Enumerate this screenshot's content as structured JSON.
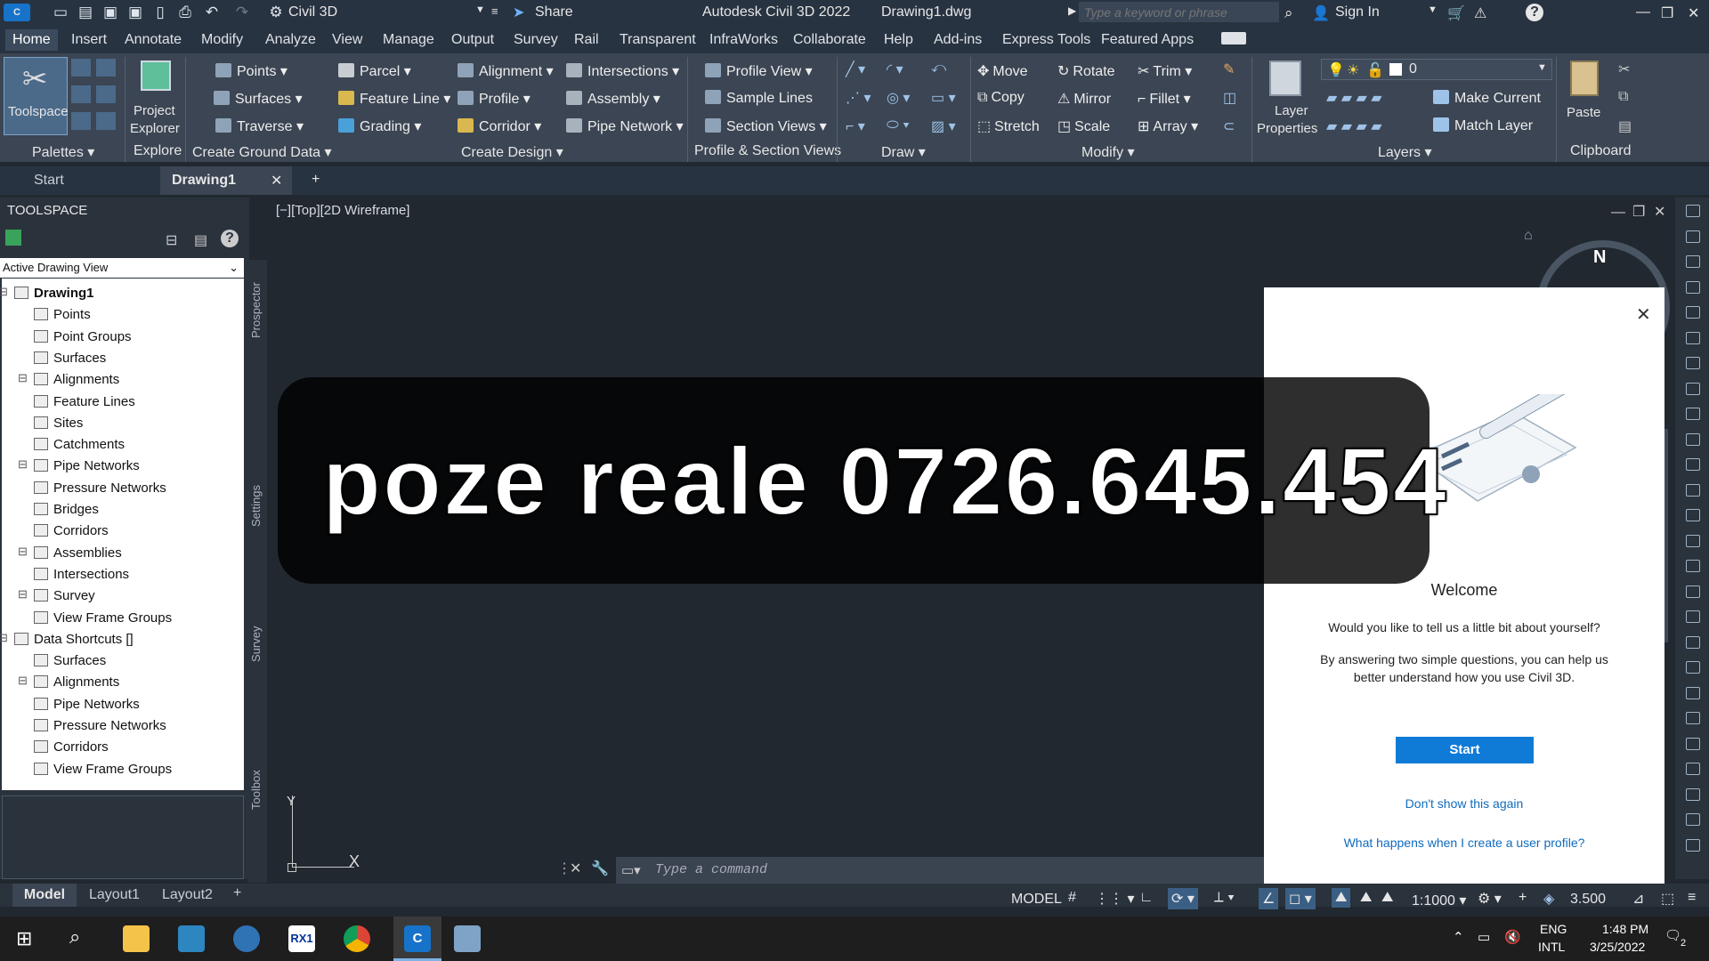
{
  "titlebar": {
    "workspace": "Civil 3D",
    "share": "Share",
    "app_title": "Autodesk Civil 3D 2022",
    "file": "Drawing1.dwg",
    "search_placeholder": "Type a keyword or phrase",
    "sign_in": "Sign In"
  },
  "ribbon_tabs": [
    "Home",
    "Insert",
    "Annotate",
    "Modify",
    "Analyze",
    "View",
    "Manage",
    "Output",
    "Survey",
    "Rail",
    "Transparent",
    "InfraWorks",
    "Collaborate",
    "Help",
    "Add-ins",
    "Express Tools",
    "Featured Apps"
  ],
  "ribbon": {
    "toolspace": "Toolspace",
    "project_explorer_1": "Project",
    "project_explorer_2": "Explorer",
    "ground": [
      "Points",
      "Surfaces",
      "Traverse",
      "Parcel",
      "Feature Line",
      "Grading"
    ],
    "design": [
      "Alignment",
      "Profile",
      "Corridor",
      "Intersections",
      "Assembly",
      "Pipe Network"
    ],
    "profile_section": [
      "Profile View",
      "Sample Lines",
      "Section Views"
    ],
    "modify": [
      "Move",
      "Copy",
      "Stretch",
      "Rotate",
      "Mirror",
      "Scale",
      "Trim",
      "Fillet",
      "Array"
    ],
    "layer_props_1": "Layer",
    "layer_props_2": "Properties",
    "layer_value": "0",
    "layer_actions": [
      "Make Current",
      "Match Layer"
    ],
    "paste": "Paste",
    "panels": {
      "palettes": "Palettes",
      "explore": "Explore",
      "create_ground": "Create Ground Data",
      "create_design": "Create Design",
      "profile_section": "Profile & Section Views",
      "draw": "Draw",
      "modify": "Modify",
      "layers": "Layers",
      "clipboard": "Clipboard"
    }
  },
  "doc_tabs": {
    "start": "Start",
    "drawing": "Drawing1"
  },
  "toolspace": {
    "title": "TOOLSPACE",
    "view_select": "Active Drawing View",
    "side_tabs": [
      "Prospector",
      "Settings",
      "Survey",
      "Toolbox"
    ],
    "tree": [
      {
        "label": "Drawing1",
        "level": 0,
        "bold": true
      },
      {
        "label": "Points",
        "level": 1
      },
      {
        "label": "Point Groups",
        "level": 1
      },
      {
        "label": "Surfaces",
        "level": 1
      },
      {
        "label": "Alignments",
        "level": 1
      },
      {
        "label": "Feature Lines",
        "level": 1
      },
      {
        "label": "Sites",
        "level": 1
      },
      {
        "label": "Catchments",
        "level": 1
      },
      {
        "label": "Pipe Networks",
        "level": 1
      },
      {
        "label": "Pressure Networks",
        "level": 1
      },
      {
        "label": "Bridges",
        "level": 1
      },
      {
        "label": "Corridors",
        "level": 1
      },
      {
        "label": "Assemblies",
        "level": 1
      },
      {
        "label": "Intersections",
        "level": 1
      },
      {
        "label": "Survey",
        "level": 1
      },
      {
        "label": "View Frame Groups",
        "level": 1
      },
      {
        "label": "Data Shortcuts []",
        "level": 0
      },
      {
        "label": "Surfaces",
        "level": 1
      },
      {
        "label": "Alignments",
        "level": 1
      },
      {
        "label": "Pipe Networks",
        "level": 1
      },
      {
        "label": "Pressure Networks",
        "level": 1
      },
      {
        "label": "Corridors",
        "level": 1
      },
      {
        "label": "View Frame Groups",
        "level": 1
      }
    ]
  },
  "viewport": {
    "label": "[−][Top][2D Wireframe]",
    "compass": "N",
    "ucs_x": "X",
    "ucs_y": "Y"
  },
  "overlay_text": "poze reale 0726.645.454",
  "welcome": {
    "title": "Welcome",
    "question": "Would you like to tell us a little bit about yourself?",
    "body": "By answering two simple questions, you can help us better understand how you use Civil 3D.",
    "start": "Start",
    "dont_show": "Don't show this again",
    "profile_link": "What happens when I create a user profile?"
  },
  "command": {
    "placeholder": "Type a command"
  },
  "layout_tabs": [
    "Model",
    "Layout1",
    "Layout2"
  ],
  "status": {
    "model": "MODEL",
    "scale": "1:1000",
    "value": "3.500"
  },
  "taskbar": {
    "lang1": "ENG",
    "lang2": "INTL",
    "time": "1:48 PM",
    "date": "3/25/2022",
    "notif": "2"
  }
}
